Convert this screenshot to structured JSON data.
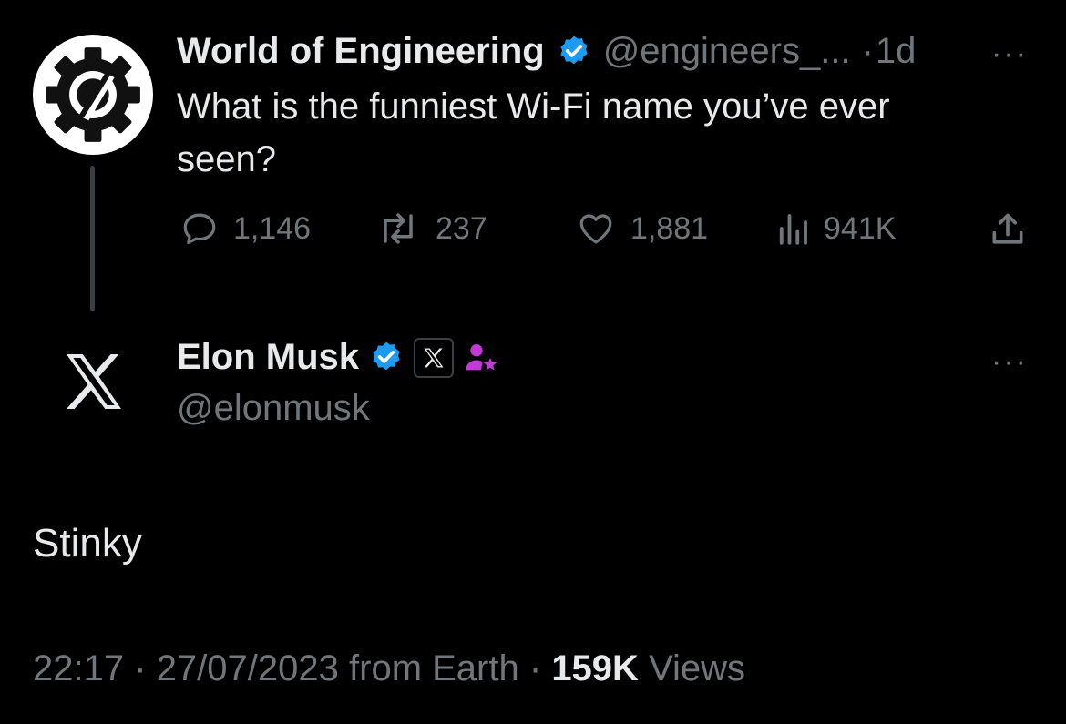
{
  "original_tweet": {
    "author_name": "World of Engineering",
    "handle": "@engineers_...",
    "separator": "·",
    "time": "1d",
    "text": "What is the funniest Wi-Fi name you’ve ever seen?",
    "stats": {
      "replies": "1,146",
      "retweets": "237",
      "likes": "1,881",
      "views": "941K"
    },
    "more": "···"
  },
  "reply_tweet": {
    "author_name": "Elon Musk",
    "handle": "@elonmusk",
    "text": "Stinky",
    "more": "···"
  },
  "footer": {
    "time": "22:17",
    "date": "27/07/2023",
    "source": "from Earth",
    "separator": "·",
    "views_count": "159K",
    "views_label": "Views"
  },
  "colors": {
    "background": "#000000",
    "text_primary": "#e7e9ea",
    "text_secondary": "#71767b",
    "verified_blue": "#1d9bf0",
    "affiliate_purple": "#c13ad3"
  }
}
